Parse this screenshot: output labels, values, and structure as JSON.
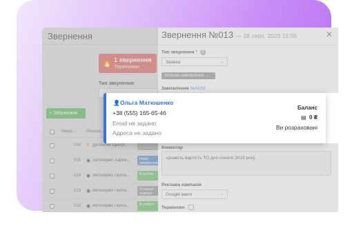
{
  "list": {
    "title": "Звернення",
    "alert": {
      "count_text": "1 звернення",
      "sub_text": "Термінових"
    },
    "type_filter_label": "Тип звернення",
    "add_button": "+ Звернення",
    "columns": [
      "Зверн...",
      "Локаци..."
    ],
    "rows": [
      {
        "num": "016",
        "location": "Детейлінг-Центр...",
        "status": "",
        "status_color": "#9aa0a6"
      },
      {
        "num": "015",
        "location": "Автосервіс Харків...",
        "status": "Нове звернення",
        "status_color": "#4a7fc1"
      },
      {
        "num": "014",
        "location": "Автосервіс Прота...",
        "status": "В роботі",
        "status_color": "#5cb85c"
      },
      {
        "num": "013",
        "location": "Автосервіс Прота...",
        "status": "Успішне замовл.",
        "status_color": "#8a8a8a"
      },
      {
        "num": "012",
        "location": "Автосервіс Прота...",
        "status": "В роботі",
        "status_color": "#5cb85c"
      }
    ]
  },
  "panel": {
    "title": "Звернення №013",
    "date": "— 28 серп. 2023 15:55",
    "type_label": "Тип звернення",
    "type_required": "*",
    "type_value": "Заявка",
    "status_chip": "Успішне замовлення",
    "order_label": "Замовлення",
    "order_link": "№A053",
    "comment_label": "Коментар",
    "comment_text": "цікавить вартість ТО для сонати 2019 року",
    "ad_label": "Реклама кампанія",
    "ad_value": "Google мапи",
    "urgent_label": "Терміново"
  },
  "customer": {
    "name": "Ольга Матюшенко",
    "phone": "+38 (555) 165-65-46",
    "email": "Email не задано",
    "address": "Адреса не задано",
    "balance_label": "Баланс",
    "balance_value": "0 ₴",
    "balance_status": "Ви розраховані"
  },
  "colors": {
    "accent": "#3a73c8",
    "alert": "#d9534f",
    "add": "#4caf50"
  }
}
